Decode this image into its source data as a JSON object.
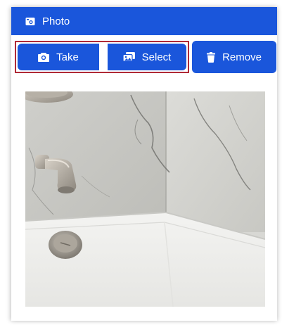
{
  "header": {
    "title": "Photo",
    "icon": "camera-photo-icon"
  },
  "toolbar": {
    "take_label": "Take",
    "take_icon": "camera-icon",
    "select_label": "Select",
    "select_icon": "gallery-icon",
    "remove_label": "Remove",
    "remove_icon": "trash-icon"
  },
  "colors": {
    "primary": "#1a56db",
    "focus_outline": "#b02a37"
  }
}
